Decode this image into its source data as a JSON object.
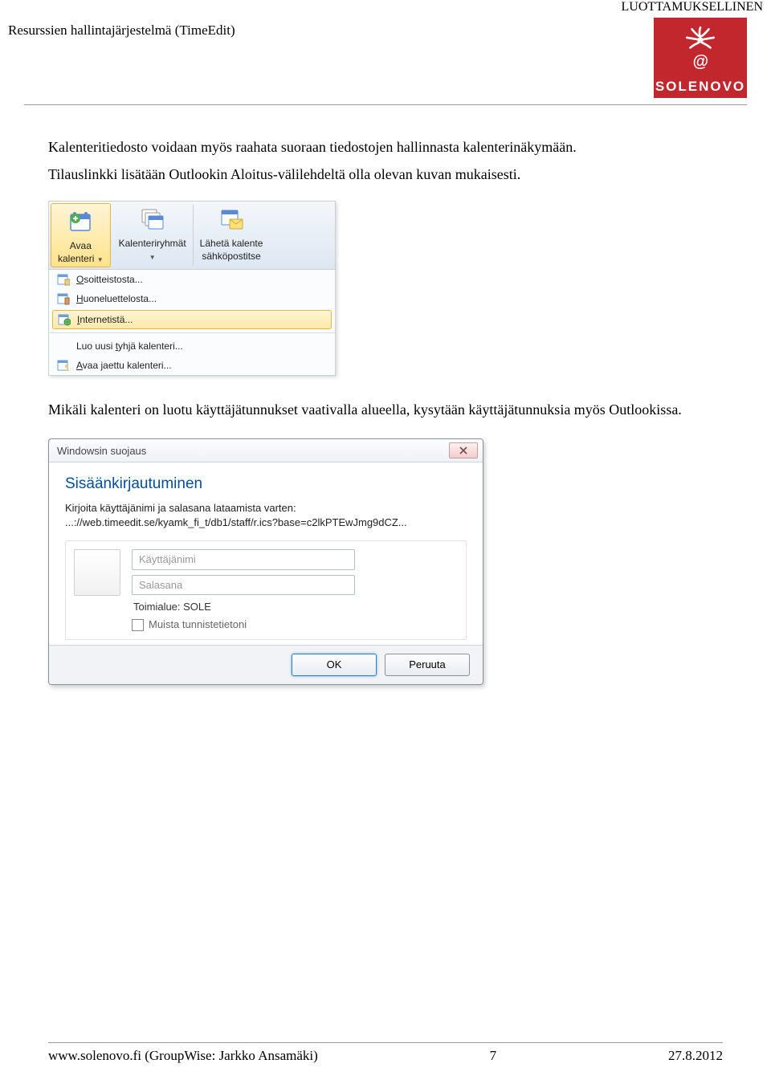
{
  "header": {
    "doc_title": "Resurssien hallintajärjestelmä (TimeEdit)",
    "confidential": "LUOTTAMUKSELLINEN",
    "logo_brand": "SOLENOVO",
    "logo_at": "@"
  },
  "body": {
    "para1": "Kalenteritiedosto voidaan myös raahata suoraan tiedostojen hallinnasta kalenterinäkymään.",
    "para2": "Tilauslinkki lisätään Outlookin Aloitus-välilehdeltä olla olevan kuvan mukaisesti.",
    "para3": "Mikäli kalenteri on luotu käyttäjätunnukset vaativalla alueella, kysytään käyttäjätunnuksia myös Outlookissa."
  },
  "ribbon": {
    "open_calendar_top": "Avaa",
    "open_calendar_bottom": "kalenteri",
    "groups": "Kalenteriryhmät",
    "send_top": "Lähetä kalente",
    "send_bottom": "sähköpostitse",
    "menu": {
      "from_address_prefix": "O",
      "from_address_rest": "soitteistosta...",
      "from_rooms_prefix": "H",
      "from_rooms_rest": "uoneluettelosta...",
      "from_internet_prefix": "I",
      "from_internet_rest": "nternetistä...",
      "new_blank_pre": "Luo uusi ",
      "new_blank_key": "t",
      "new_blank_post": "yhjä kalenteri...",
      "open_shared_prefix": "A",
      "open_shared_rest": "vaa jaettu kalenteri..."
    }
  },
  "dialog": {
    "title": "Windowsin suojaus",
    "heading": "Sisäänkirjautuminen",
    "instr_line1": "Kirjoita käyttäjänimi ja salasana lataamista varten:",
    "instr_line2": "...://web.timeedit.se/kyamk_fi_t/db1/staff/r.ics?base=c2lkPTEwJmg9dCZ...",
    "username_placeholder": "Käyttäjänimi",
    "password_placeholder": "Salasana",
    "domain_label": "Toimialue: SOLE",
    "remember": "Muista tunnistetietoni",
    "ok": "OK",
    "cancel": "Peruuta"
  },
  "footer": {
    "left": "www.solenovo.fi  (GroupWise: Jarkko Ansamäki)",
    "center": "7",
    "right": "27.8.2012"
  }
}
